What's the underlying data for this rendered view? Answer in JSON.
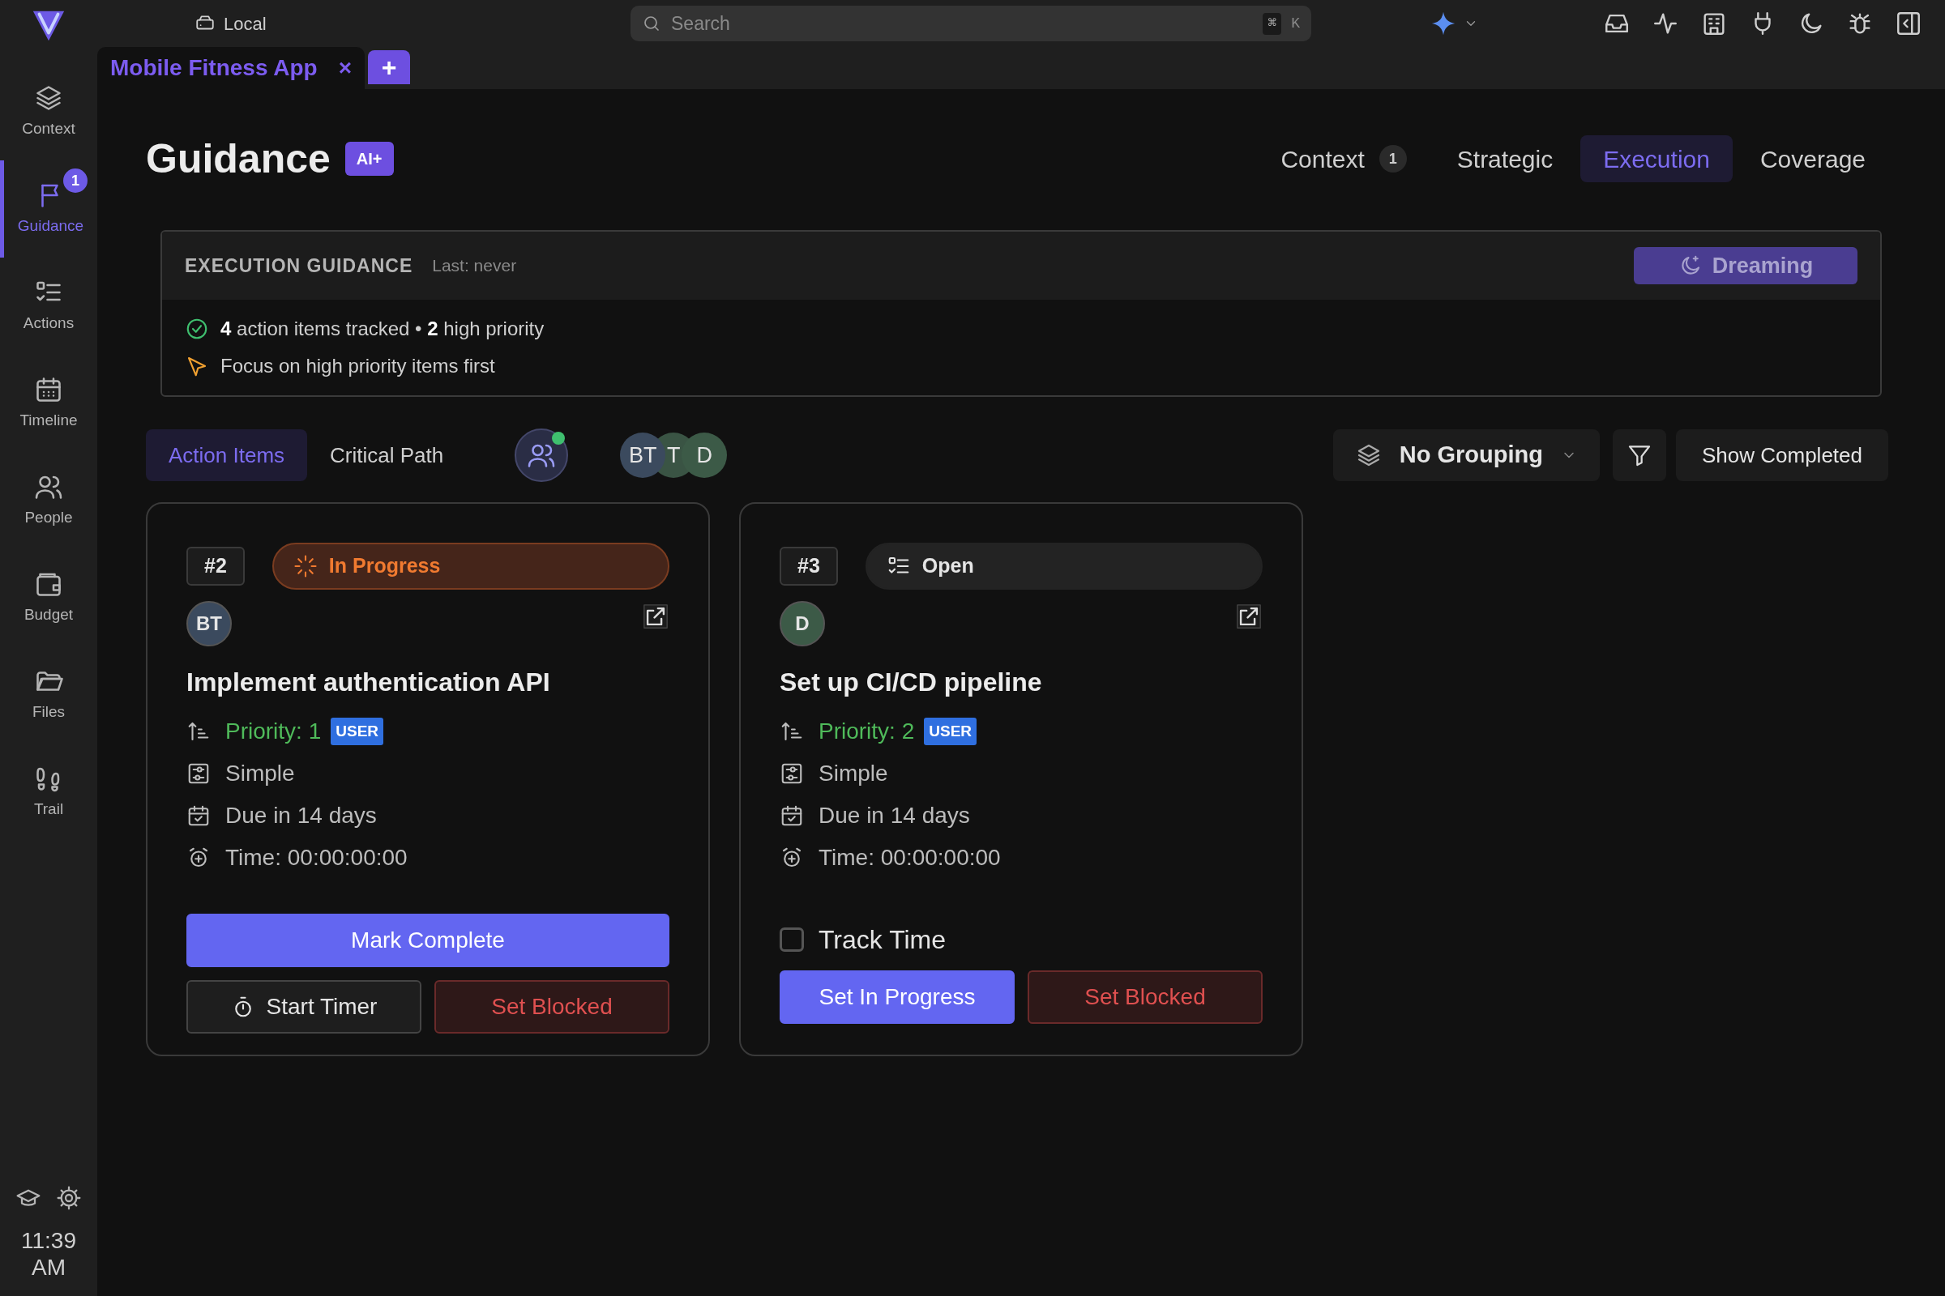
{
  "top_bar": {
    "workspace": "Local",
    "search": {
      "placeholder": "Search",
      "shortcut": [
        "⌘",
        "K"
      ]
    }
  },
  "tabs": [
    {
      "label": "Mobile Fitness App",
      "selected": true,
      "close": "×"
    }
  ],
  "new_tab": "+",
  "sidebar": {
    "items": [
      {
        "label": "Context",
        "selected": false
      },
      {
        "label": "Guidance",
        "selected": true,
        "badge": "1"
      },
      {
        "label": "Actions",
        "selected": false
      },
      {
        "label": "Timeline",
        "selected": false
      },
      {
        "label": "People",
        "selected": false
      },
      {
        "label": "Budget",
        "selected": false
      },
      {
        "label": "Files",
        "selected": false
      },
      {
        "label": "Trail",
        "selected": false
      }
    ],
    "clock": {
      "time": "11:39",
      "period": "AM"
    }
  },
  "header": {
    "title": "Guidance",
    "badge": "AI+",
    "views": [
      {
        "label": "Context",
        "count": "1",
        "selected": false
      },
      {
        "label": "Strategic",
        "selected": false
      },
      {
        "label": "Execution",
        "selected": true
      },
      {
        "label": "Coverage",
        "selected": false
      }
    ]
  },
  "guidance": {
    "title": "EXECUTION GUIDANCE",
    "last_run": "Last: never",
    "button": "Dreaming",
    "lines": [
      {
        "kind": "success",
        "text": "**4** action items tracked • **2** high priority"
      },
      {
        "kind": "tip",
        "text": "Focus on high priority items first"
      }
    ]
  },
  "toolbar": {
    "tabs": [
      {
        "label": "Action Items",
        "selected": true
      },
      {
        "label": "Critical Path",
        "selected": false
      }
    ],
    "team_online": true,
    "avatars": [
      {
        "initials": "BT",
        "color": "#3b4a5e"
      },
      {
        "initials": "T",
        "color": "#3a5444"
      },
      {
        "initials": "D",
        "color": "#3c5a47"
      }
    ],
    "grouping": "No Grouping",
    "show_completed": "Show Completed"
  },
  "cards": [
    {
      "number": "#2",
      "status": {
        "kind": "in_progress",
        "label": "In Progress"
      },
      "assignee": {
        "initials": "BT",
        "color": "#3b4a5e"
      },
      "title": "Implement authentication API",
      "priority": "Priority: 1",
      "priority_source": "USER",
      "complexity": "Simple",
      "due": "Due in 14 days",
      "time": "Time: 00:00:00:00",
      "action_rows": [
        [
          {
            "kind": "primary",
            "label": "Mark Complete"
          }
        ],
        [
          {
            "kind": "timer",
            "label": "Start Timer"
          },
          {
            "kind": "danger",
            "label": "Set Blocked"
          }
        ]
      ]
    },
    {
      "number": "#3",
      "status": {
        "kind": "open",
        "label": "Open"
      },
      "assignee": {
        "initials": "D",
        "color": "#3c5a47"
      },
      "title": "Set up CI/CD pipeline",
      "priority": "Priority: 2",
      "priority_source": "USER",
      "complexity": "Simple",
      "due": "Due in 14 days",
      "time": "Time: 00:00:00:00",
      "track_time": {
        "label": "Track Time",
        "checked": false
      },
      "action_rows": [
        [
          {
            "kind": "primary",
            "label": "Set In Progress"
          },
          {
            "kind": "danger",
            "label": "Set Blocked"
          }
        ]
      ]
    }
  ]
}
